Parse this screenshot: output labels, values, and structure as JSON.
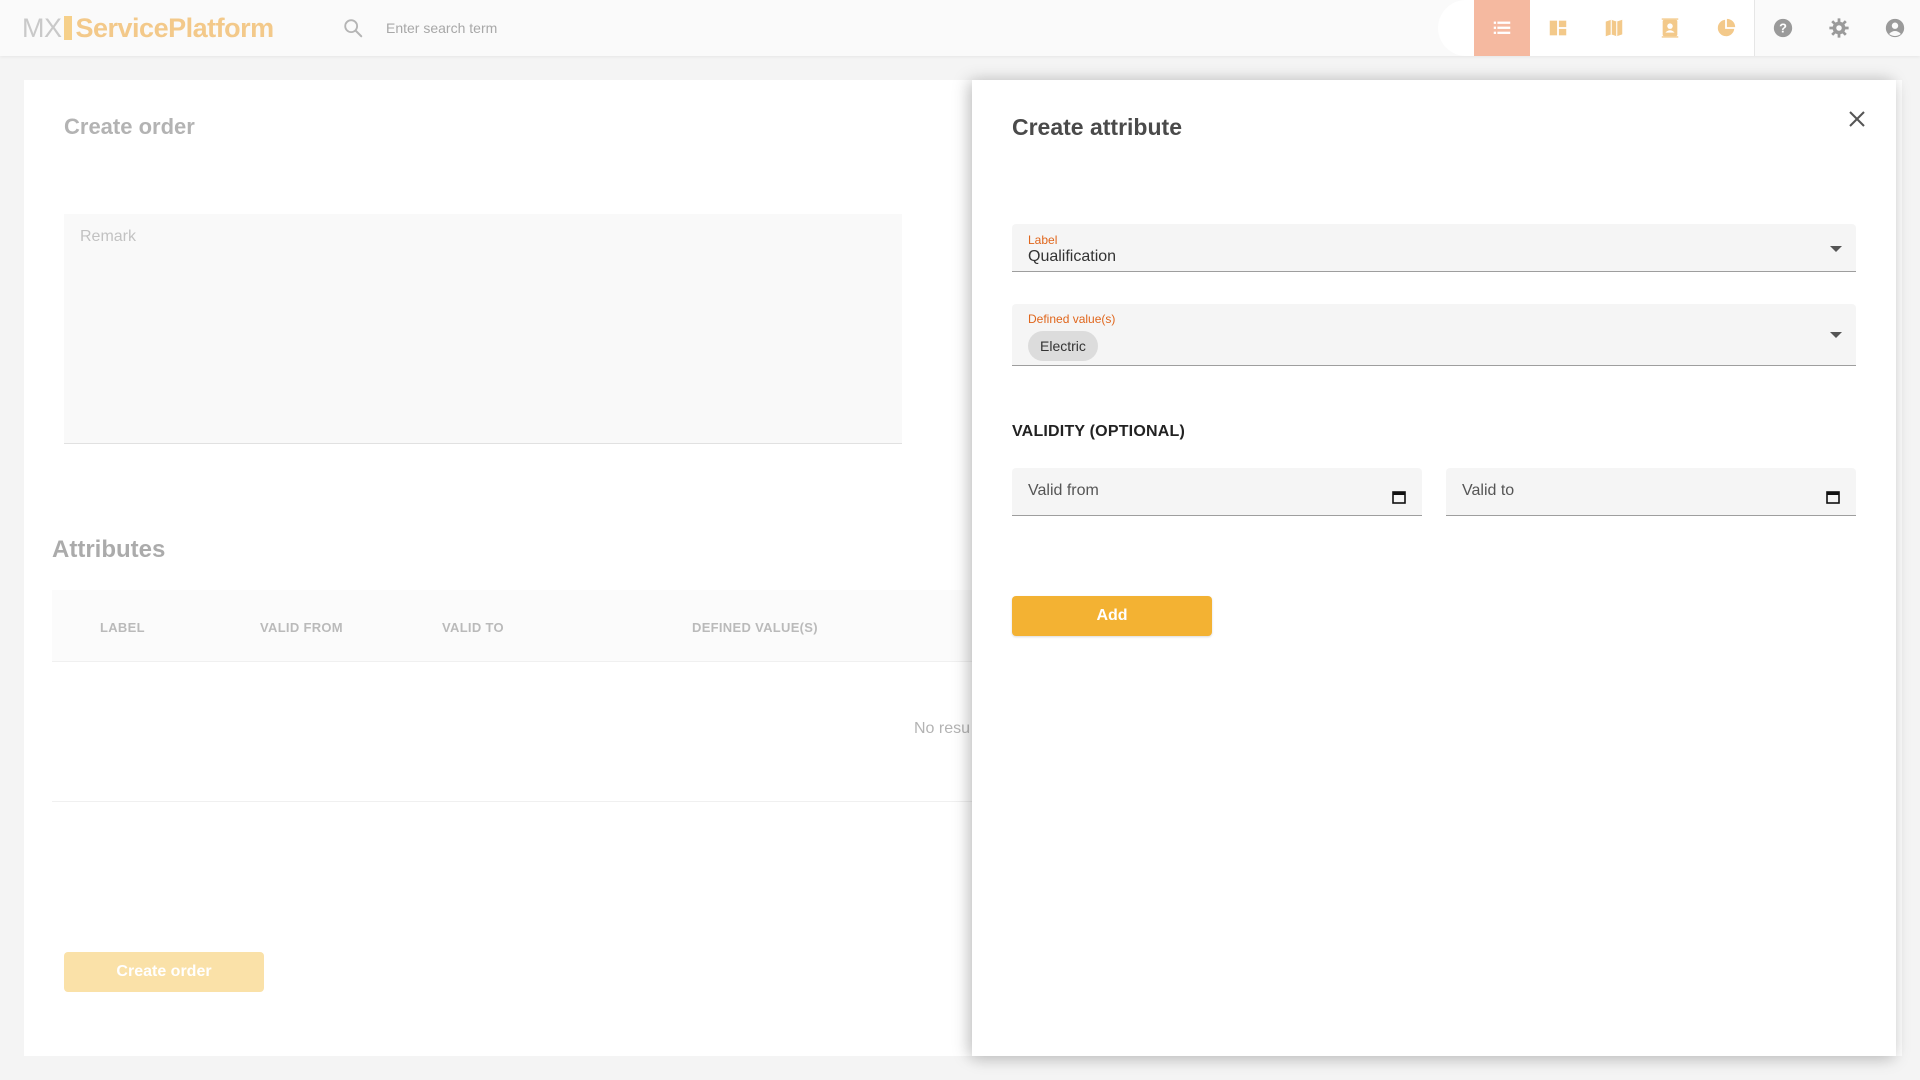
{
  "topbar": {
    "logo_mx": "MX",
    "logo_name": "ServicePlatform",
    "search_placeholder": "Enter search term",
    "nav_icons": [
      "list-icon",
      "dashboard-icon",
      "map-icon",
      "contacts-icon",
      "pie-chart-icon"
    ],
    "util_icons": [
      "help-icon",
      "gear-icon",
      "account-icon"
    ],
    "accent_active": "#f5b9a0",
    "icon_color": "#f3c98a"
  },
  "background_page": {
    "title": "Create order",
    "remark_label": "Remark",
    "attributes_title": "Attributes",
    "table_headers": [
      "LABEL",
      "VALID FROM",
      "VALID TO",
      "DEFINED VALUE(S)"
    ],
    "no_results_text": "No resu",
    "create_order_label": "Create order"
  },
  "dialog": {
    "title": "Create attribute",
    "label_field": {
      "label": "Label",
      "value": "Qualification"
    },
    "defined_values_field": {
      "label": "Defined value(s)",
      "chips": [
        "Electric"
      ]
    },
    "validity_title": "VALIDITY (OPTIONAL)",
    "valid_from_label": "Valid from",
    "valid_to_label": "Valid to",
    "add_label": "Add",
    "accent_label_color": "#e0661c",
    "button_color": "#f3b233"
  }
}
